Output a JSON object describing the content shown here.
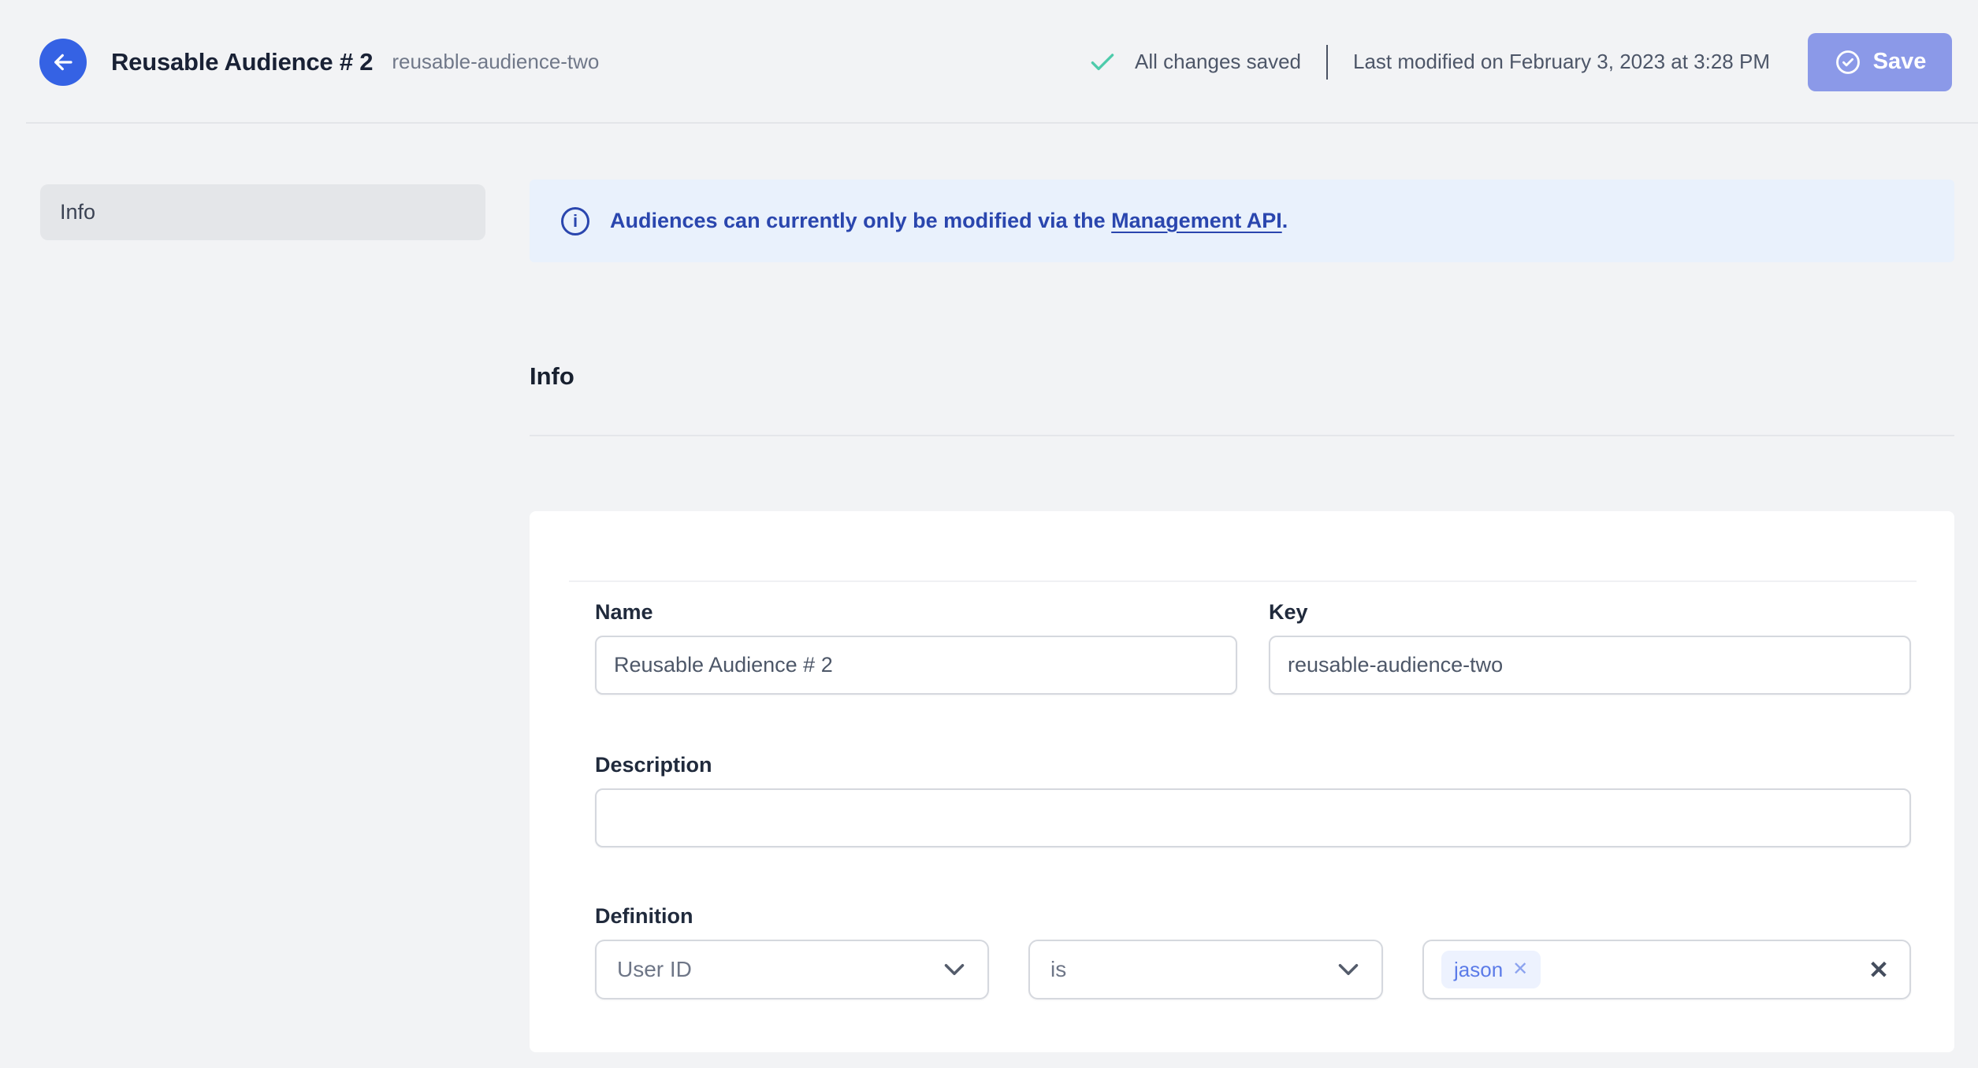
{
  "header": {
    "title": "Reusable Audience # 2",
    "subtitle": "reusable-audience-two",
    "status": "All changes saved",
    "last_modified": "Last modified on February 3, 2023 at 3:28 PM",
    "save_label": "Save"
  },
  "sidebar": {
    "items": [
      {
        "label": "Info",
        "active": true
      }
    ]
  },
  "banner": {
    "text_before_link": "Audiences can currently only be modified via the ",
    "link_text": "Management API",
    "text_after_link": "."
  },
  "section": {
    "heading": "Info"
  },
  "form": {
    "name": {
      "label": "Name",
      "value": "Reusable Audience # 2"
    },
    "key": {
      "label": "Key",
      "value": "reusable-audience-two"
    },
    "description": {
      "label": "Description",
      "value": ""
    },
    "definition": {
      "label": "Definition",
      "attribute_selected": "User ID",
      "operator_selected": "is",
      "values": [
        "jason"
      ]
    }
  },
  "icons": {
    "back": "arrow-left",
    "status": "checkmark",
    "save": "check-circle",
    "banner": "info-circle",
    "banner_glyph": "i",
    "select": "chevron-down",
    "chip_remove_glyph": "✕",
    "clear_glyph": "✕"
  },
  "colors": {
    "page_bg": "#f2f3f5",
    "card_bg": "#ffffff",
    "back_button_blue": "#3562e4",
    "save_button_blue": "#8b99e8",
    "success_green": "#4ecbab",
    "banner_bg": "#e9f1fc",
    "banner_text": "#2a46ae",
    "chip_bg": "#edf2fe",
    "chip_text": "#5b7be8",
    "input_border": "#d5d8de"
  }
}
